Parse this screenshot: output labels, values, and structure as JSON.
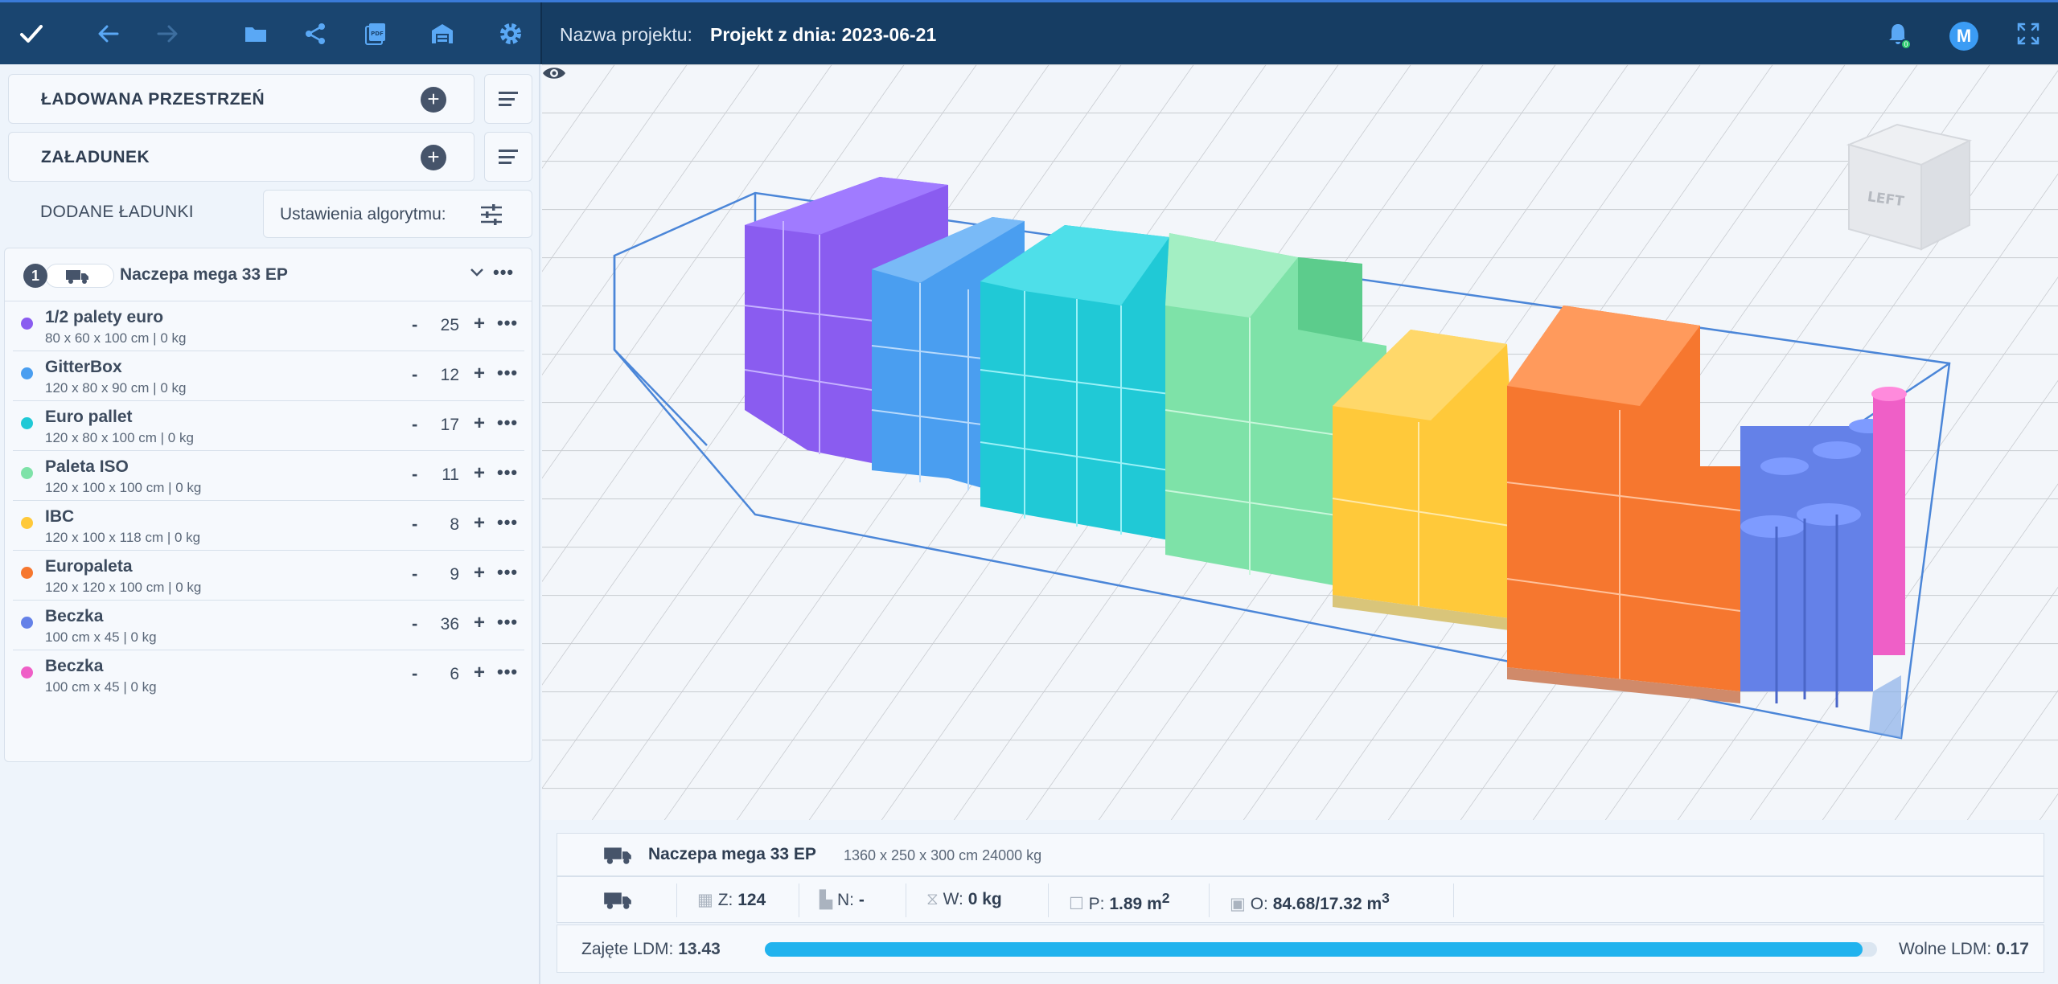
{
  "project": {
    "label": "Nazwa projektu:",
    "name": "Projekt z dnia: 2023-06-21",
    "user_initial": "M",
    "notifications": "0"
  },
  "toolbar": {
    "icons": [
      "check-icon",
      "undo-icon",
      "redo-icon",
      "folder-icon",
      "share-icon",
      "pdf-icon",
      "warehouse-icon",
      "settings-icon"
    ]
  },
  "panel": {
    "space_title": "ŁADOWANA PRZESTRZEŃ",
    "loading_title": "ZAŁADUNEK",
    "added_title": "DODANE ŁADUNKI",
    "algo_label": "Ustawienia algorytmu:"
  },
  "truck": {
    "index": "1",
    "name": "Naczepa mega 33 EP"
  },
  "items": [
    {
      "name": "1/2 palety euro",
      "dims": "80 x 60 x 100 cm | 0 kg",
      "qty": "25",
      "color": "#8a5cf0"
    },
    {
      "name": "GitterBox",
      "dims": "120 x 80 x 90 cm | 0 kg",
      "qty": "12",
      "color": "#4a9ef0"
    },
    {
      "name": "Euro pallet",
      "dims": "120 x 80 x 100 cm | 0 kg",
      "qty": "17",
      "color": "#20c9d6"
    },
    {
      "name": "Paleta ISO",
      "dims": "120 x 100 x 100 cm | 0 kg",
      "qty": "11",
      "color": "#7ee2a8"
    },
    {
      "name": "IBC",
      "dims": "120 x 100 x 118 cm | 0 kg",
      "qty": "8",
      "color": "#ffc93a"
    },
    {
      "name": "Europaleta",
      "dims": "120 x 120 x 100 cm | 0 kg",
      "qty": "9",
      "color": "#f6772f"
    },
    {
      "name": "Beczka",
      "dims": "100 cm x 45 | 0 kg",
      "qty": "36",
      "color": "#6481e8"
    },
    {
      "name": "Beczka",
      "dims": "100 cm x 45 | 0 kg",
      "qty": "6",
      "color": "#ef5fc7"
    }
  ],
  "qty_controls": {
    "minus": "-",
    "plus": "+",
    "more": "•••"
  },
  "viewcube": {
    "face": "LEFT"
  },
  "bottom": {
    "truck_name": "Naczepa mega 33 EP",
    "truck_dims": "1360 x 250 x 300 cm 24000 kg",
    "stats": {
      "z_label": "Z:",
      "z_value": "124",
      "n_label": "N:",
      "n_value": "-",
      "w_label": "W:",
      "w_value": "0 kg",
      "p_label": "P:",
      "p_value": "1.89 m",
      "p_sup": "2",
      "o_label": "O:",
      "o_value": "84.68/17.32 m",
      "o_sup": "3"
    },
    "ldm_used_label": "Zajęte LDM:",
    "ldm_used": "13.43",
    "ldm_free_label": "Wolne LDM:",
    "ldm_free": "0.17",
    "ldm_fill": 0.987
  }
}
